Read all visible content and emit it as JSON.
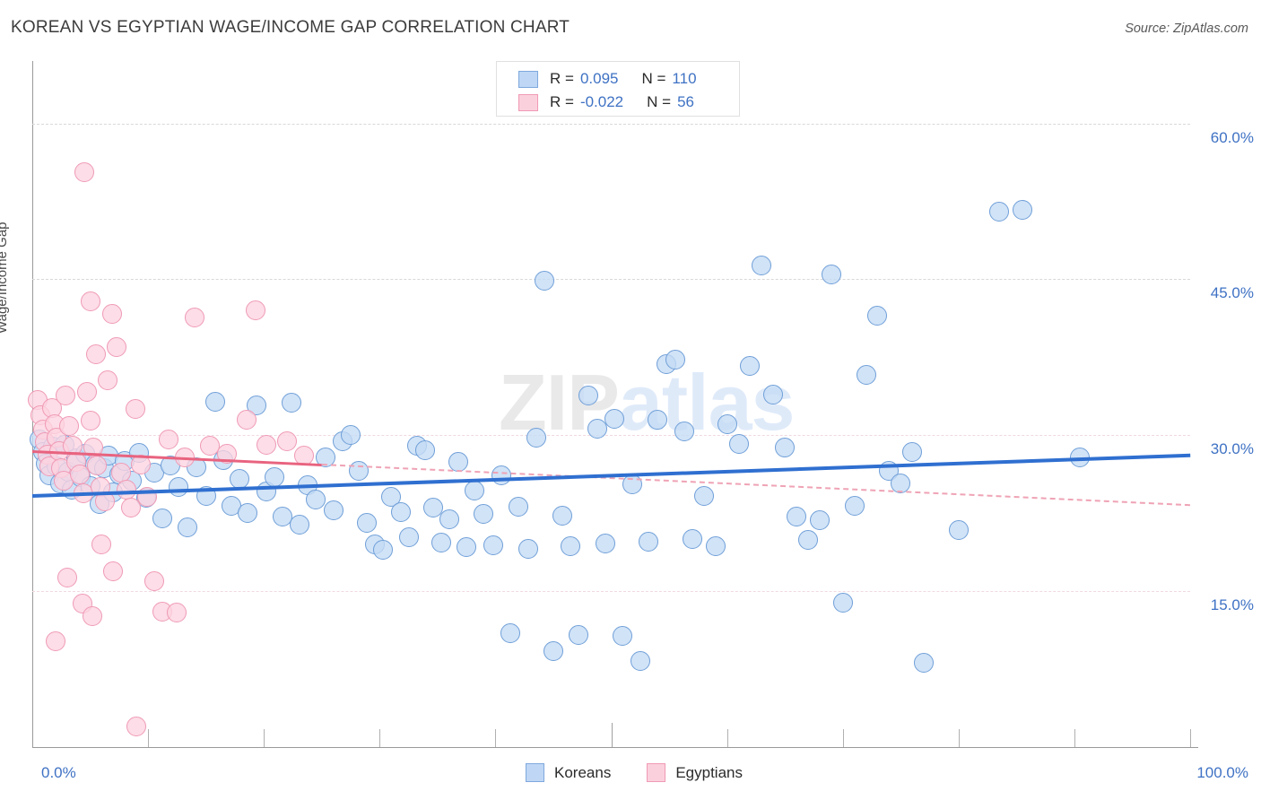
{
  "header": {
    "title": "KOREAN VS EGYPTIAN WAGE/INCOME GAP CORRELATION CHART",
    "source": "Source: ZipAtlas.com"
  },
  "watermark": {
    "part1": "ZIP",
    "part2": "atlas"
  },
  "stats_legend": {
    "rows": [
      {
        "series": "Koreans",
        "r_label": "R =",
        "r_value": "0.095",
        "n_label": "N =",
        "n_value": "110",
        "color": "#bfd7f5"
      },
      {
        "series": "Egyptians",
        "r_label": "R =",
        "r_value": "-0.022",
        "n_label": "N =",
        "n_value": "56",
        "color": "#fbd0dd"
      }
    ]
  },
  "bottom_legend": {
    "items": [
      {
        "label": "Koreans",
        "color": "#bfd7f5"
      },
      {
        "label": "Egyptians",
        "color": "#fbd0dd"
      }
    ]
  },
  "chart_data": {
    "type": "scatter",
    "title": "KOREAN VS EGYPTIAN WAGE/INCOME GAP CORRELATION CHART",
    "xlabel": "",
    "ylabel": "Wage/Income Gap",
    "xlim": [
      0,
      100
    ],
    "ylim": [
      0,
      66
    ],
    "x_tick_labels": [
      "0.0%",
      "100.0%"
    ],
    "y_tick_labels": [
      "60.0%",
      "45.0%",
      "30.0%",
      "15.0%"
    ],
    "y_ticks": [
      60,
      45,
      30,
      15
    ],
    "grid": true,
    "legend_position": "bottom-center",
    "series": [
      {
        "name": "Koreans",
        "color": "#bfd7f5",
        "edge_color": "#6f9fd8",
        "r": 0.095,
        "n": 110,
        "trend": {
          "style": "solid",
          "color": "#2f6fd0",
          "x0": 0,
          "y0": 24.3,
          "x1": 100,
          "y1": 28.2
        },
        "points": [
          [
            0.6,
            29.6
          ],
          [
            0.9,
            28.4
          ],
          [
            1.2,
            27.3
          ],
          [
            1.5,
            26.1
          ],
          [
            1.8,
            28.9
          ],
          [
            2.1,
            27.0
          ],
          [
            2.4,
            25.4
          ],
          [
            2.8,
            29.1
          ],
          [
            3.1,
            26.5
          ],
          [
            3.4,
            24.8
          ],
          [
            3.8,
            27.8
          ],
          [
            4.2,
            26.0
          ],
          [
            4.6,
            28.2
          ],
          [
            5.0,
            25.1
          ],
          [
            5.4,
            27.2
          ],
          [
            5.8,
            23.4
          ],
          [
            6.2,
            26.8
          ],
          [
            6.6,
            28.0
          ],
          [
            7.0,
            24.5
          ],
          [
            7.5,
            26.2
          ],
          [
            8.0,
            27.5
          ],
          [
            8.6,
            25.6
          ],
          [
            9.2,
            28.3
          ],
          [
            9.8,
            24.0
          ],
          [
            10.5,
            26.4
          ],
          [
            11.2,
            22.0
          ],
          [
            11.9,
            27.1
          ],
          [
            12.6,
            25.0
          ],
          [
            13.4,
            21.1
          ],
          [
            14.2,
            26.9
          ],
          [
            15.0,
            24.2
          ],
          [
            15.8,
            33.2
          ],
          [
            16.5,
            27.6
          ],
          [
            17.2,
            23.2
          ],
          [
            17.9,
            25.8
          ],
          [
            18.6,
            22.5
          ],
          [
            19.4,
            32.9
          ],
          [
            20.2,
            24.6
          ],
          [
            20.9,
            26.0
          ],
          [
            21.6,
            22.2
          ],
          [
            22.4,
            33.1
          ],
          [
            23.1,
            21.4
          ],
          [
            23.8,
            25.2
          ],
          [
            24.5,
            23.8
          ],
          [
            25.3,
            27.9
          ],
          [
            26.0,
            22.8
          ],
          [
            26.8,
            29.4
          ],
          [
            27.5,
            30.0
          ],
          [
            28.2,
            26.6
          ],
          [
            28.9,
            21.6
          ],
          [
            29.6,
            19.5
          ],
          [
            30.3,
            19.0
          ],
          [
            31.0,
            24.1
          ],
          [
            31.8,
            22.6
          ],
          [
            32.5,
            20.2
          ],
          [
            33.2,
            29.0
          ],
          [
            33.9,
            28.6
          ],
          [
            34.6,
            23.0
          ],
          [
            35.3,
            19.7
          ],
          [
            36.0,
            21.9
          ],
          [
            36.8,
            27.4
          ],
          [
            37.5,
            19.2
          ],
          [
            38.2,
            24.7
          ],
          [
            39.0,
            22.4
          ],
          [
            39.8,
            19.4
          ],
          [
            40.5,
            26.1
          ],
          [
            41.3,
            11.0
          ],
          [
            42.0,
            23.1
          ],
          [
            42.8,
            19.1
          ],
          [
            43.5,
            29.8
          ],
          [
            44.2,
            44.9
          ],
          [
            45.0,
            9.2
          ],
          [
            45.8,
            22.3
          ],
          [
            46.5,
            19.3
          ],
          [
            47.2,
            10.8
          ],
          [
            48.0,
            33.8
          ],
          [
            48.8,
            30.6
          ],
          [
            49.5,
            19.6
          ],
          [
            50.3,
            31.6
          ],
          [
            51.0,
            10.7
          ],
          [
            51.8,
            25.3
          ],
          [
            52.5,
            8.3
          ],
          [
            53.2,
            19.8
          ],
          [
            54.0,
            31.5
          ],
          [
            54.8,
            36.8
          ],
          [
            55.5,
            37.3
          ],
          [
            56.3,
            30.4
          ],
          [
            57.0,
            20.0
          ],
          [
            58.0,
            24.2
          ],
          [
            59.0,
            19.3
          ],
          [
            60.0,
            31.1
          ],
          [
            61.0,
            29.2
          ],
          [
            62.0,
            36.7
          ],
          [
            63.0,
            46.3
          ],
          [
            64.0,
            33.9
          ],
          [
            65.0,
            28.8
          ],
          [
            66.0,
            22.2
          ],
          [
            67.0,
            19.9
          ],
          [
            68.0,
            21.8
          ],
          [
            69.0,
            45.5
          ],
          [
            70.0,
            13.9
          ],
          [
            71.0,
            23.2
          ],
          [
            72.0,
            35.8
          ],
          [
            73.0,
            41.5
          ],
          [
            74.0,
            26.6
          ],
          [
            75.0,
            25.4
          ],
          [
            76.0,
            28.4
          ],
          [
            77.0,
            8.1
          ],
          [
            80.0,
            20.9
          ],
          [
            83.5,
            51.5
          ],
          [
            85.5,
            51.7
          ],
          [
            90.5,
            27.9
          ]
        ]
      },
      {
        "name": "Egyptians",
        "color": "#fbd0dd",
        "edge_color": "#ef9ab5",
        "r": -0.022,
        "n": 56,
        "trend": {
          "style": "solid-then-dashed",
          "color": "#e8637f",
          "dash_color": "#efa3b5",
          "x0": 0,
          "y0": 28.6,
          "x1": 100,
          "y1": 23.4,
          "dash_start_x": 25
        },
        "points": [
          [
            0.5,
            33.4
          ],
          [
            0.7,
            31.9
          ],
          [
            0.9,
            30.5
          ],
          [
            1.1,
            29.3
          ],
          [
            1.3,
            28.1
          ],
          [
            1.5,
            27.0
          ],
          [
            1.7,
            32.6
          ],
          [
            1.9,
            31.1
          ],
          [
            2.1,
            29.8
          ],
          [
            2.3,
            28.5
          ],
          [
            2.5,
            26.8
          ],
          [
            2.7,
            25.6
          ],
          [
            2.9,
            33.8
          ],
          [
            3.2,
            30.9
          ],
          [
            3.5,
            29.0
          ],
          [
            3.8,
            27.4
          ],
          [
            4.1,
            26.2
          ],
          [
            4.4,
            24.4
          ],
          [
            4.7,
            34.2
          ],
          [
            5.0,
            31.4
          ],
          [
            5.3,
            28.8
          ],
          [
            5.6,
            27.1
          ],
          [
            5.9,
            25.0
          ],
          [
            6.3,
            23.6
          ],
          [
            5.0,
            42.9
          ],
          [
            5.5,
            37.8
          ],
          [
            6.5,
            35.3
          ],
          [
            6.9,
            41.7
          ],
          [
            7.3,
            38.5
          ],
          [
            7.7,
            26.4
          ],
          [
            8.1,
            24.8
          ],
          [
            8.5,
            23.0
          ],
          [
            4.5,
            55.3
          ],
          [
            2.0,
            10.2
          ],
          [
            3.0,
            16.3
          ],
          [
            4.3,
            13.8
          ],
          [
            5.2,
            12.6
          ],
          [
            6.0,
            19.5
          ],
          [
            7.0,
            16.9
          ],
          [
            8.9,
            32.5
          ],
          [
            9.4,
            27.2
          ],
          [
            9.9,
            24.1
          ],
          [
            10.5,
            16.0
          ],
          [
            11.2,
            13.0
          ],
          [
            11.8,
            29.6
          ],
          [
            12.5,
            12.9
          ],
          [
            13.2,
            27.9
          ],
          [
            14.0,
            41.3
          ],
          [
            15.3,
            29.0
          ],
          [
            16.8,
            28.2
          ],
          [
            18.5,
            31.5
          ],
          [
            19.3,
            42.0
          ],
          [
            20.2,
            29.1
          ],
          [
            22.0,
            29.4
          ],
          [
            23.5,
            28.0
          ],
          [
            9.0,
            2.0
          ]
        ]
      }
    ]
  }
}
